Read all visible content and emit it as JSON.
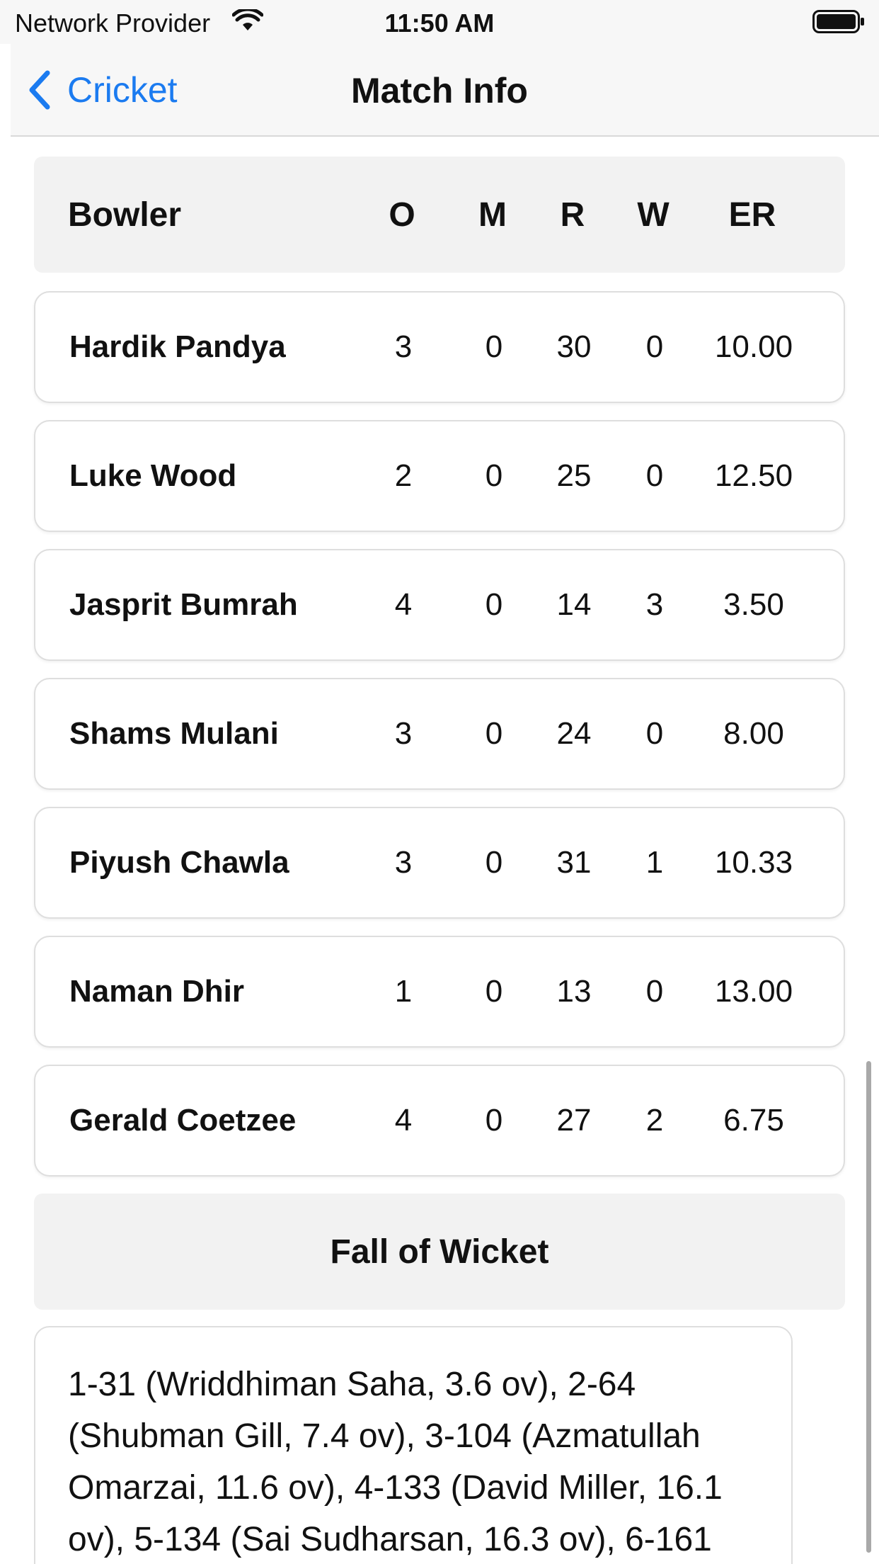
{
  "status_bar": {
    "provider": "Network Provider",
    "time": "11:50 AM"
  },
  "nav": {
    "back_label": "Cricket",
    "title": "Match Info"
  },
  "bowling_table": {
    "headers": {
      "bowler": "Bowler",
      "overs": "O",
      "maidens": "M",
      "runs": "R",
      "wickets": "W",
      "economy": "ER"
    },
    "rows": [
      {
        "name": "Hardik Pandya",
        "o": "3",
        "m": "0",
        "r": "30",
        "w": "0",
        "er": "10.00"
      },
      {
        "name": "Luke Wood",
        "o": "2",
        "m": "0",
        "r": "25",
        "w": "0",
        "er": "12.50"
      },
      {
        "name": "Jasprit Bumrah",
        "o": "4",
        "m": "0",
        "r": "14",
        "w": "3",
        "er": "3.50"
      },
      {
        "name": "Shams Mulani",
        "o": "3",
        "m": "0",
        "r": "24",
        "w": "0",
        "er": "8.00"
      },
      {
        "name": "Piyush Chawla",
        "o": "3",
        "m": "0",
        "r": "31",
        "w": "1",
        "er": "10.33"
      },
      {
        "name": "Naman Dhir",
        "o": "1",
        "m": "0",
        "r": "13",
        "w": "0",
        "er": "13.00"
      },
      {
        "name": "Gerald Coetzee",
        "o": "4",
        "m": "0",
        "r": "27",
        "w": "2",
        "er": "6.75"
      }
    ]
  },
  "fall_of_wicket": {
    "title": "Fall of Wicket",
    "text": "1-31 (Wriddhiman Saha, 3.6 ov), 2-64 (Shubman Gill, 7.4 ov), 3-104 (Azmatullah Omarzai, 11.6 ov), 4-133 (David Miller, 16.1 ov), 5-134 (Sai Sudharsan, 16.3 ov), 6-161"
  },
  "icons": {
    "wifi": "wifi-icon",
    "battery": "battery-icon",
    "back": "chevron-left-icon"
  },
  "colors": {
    "accent": "#1b7bf0",
    "bar_background": "#f7f7f7",
    "header_background": "#f2f2f2"
  }
}
